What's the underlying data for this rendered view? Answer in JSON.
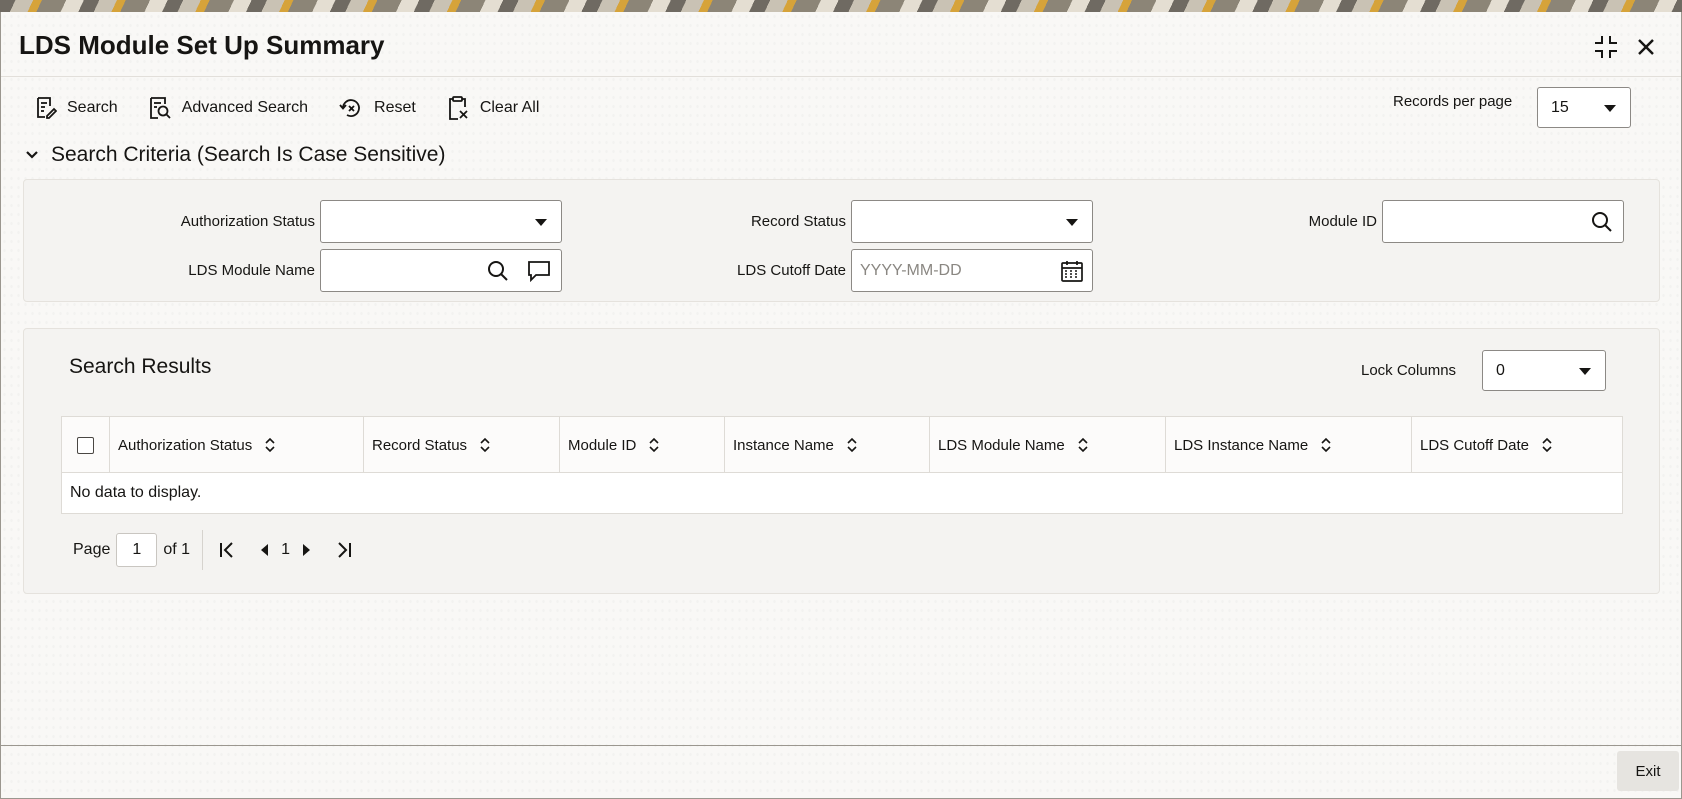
{
  "window": {
    "title": "LDS Module Set Up Summary"
  },
  "toolbar": {
    "search": "Search",
    "advanced_search": "Advanced Search",
    "reset": "Reset",
    "clear_all": "Clear All",
    "records_per_page_label": "Records per page",
    "records_per_page_value": "15"
  },
  "criteria": {
    "header": "Search Criteria (Search Is Case Sensitive)",
    "authorization_status_label": "Authorization Status",
    "authorization_status_value": "",
    "record_status_label": "Record Status",
    "record_status_value": "",
    "module_id_label": "Module ID",
    "module_id_value": "",
    "lds_module_name_label": "LDS Module Name",
    "lds_module_name_value": "",
    "lds_cutoff_date_label": "LDS Cutoff Date",
    "lds_cutoff_date_placeholder": "YYYY-MM-DD"
  },
  "results": {
    "title": "Search Results",
    "lock_columns_label": "Lock Columns",
    "lock_columns_value": "0",
    "columns": [
      "Authorization Status",
      "Record Status",
      "Module ID",
      "Instance Name",
      "LDS Module Name",
      "LDS Instance Name",
      "LDS Cutoff Date"
    ],
    "empty_message": "No data to display."
  },
  "pagination": {
    "page_label": "Page",
    "page_value": "1",
    "of_label": "of 1",
    "current": "1"
  },
  "footer": {
    "exit": "Exit"
  },
  "colors": {
    "text": "#161513",
    "border": "#8c8985",
    "panel": "#f4f3f1"
  }
}
